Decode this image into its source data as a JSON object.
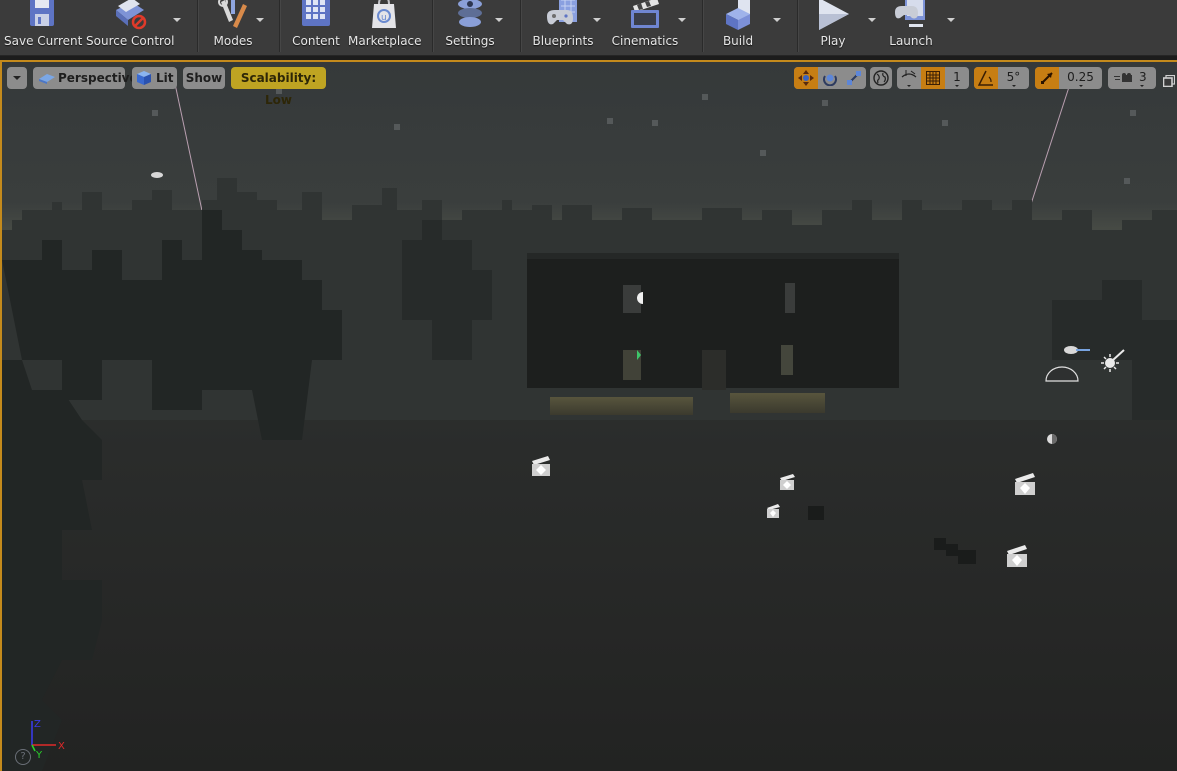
{
  "toolbar": {
    "buttons": [
      {
        "label": "Save Current",
        "icon": "floppy-disk-icon",
        "has_menu": false
      },
      {
        "label": "Source Control",
        "icon": "source-control-icon",
        "has_menu": true
      },
      {
        "label": "Modes",
        "icon": "modes-tools-icon",
        "has_menu": true
      },
      {
        "label": "Content",
        "icon": "content-grid-icon",
        "has_menu": false
      },
      {
        "label": "Marketplace",
        "icon": "marketplace-bag-icon",
        "has_menu": false
      },
      {
        "label": "Settings",
        "icon": "settings-gear-icon",
        "has_menu": true
      },
      {
        "label": "Blueprints",
        "icon": "blueprints-gamepad-icon",
        "has_menu": true
      },
      {
        "label": "Cinematics",
        "icon": "cinematics-clapper-icon",
        "has_menu": true
      },
      {
        "label": "Build",
        "icon": "build-blocks-icon",
        "has_menu": true
      },
      {
        "label": "Play",
        "icon": "play-triangle-icon",
        "has_menu": true
      },
      {
        "label": "Launch",
        "icon": "launch-console-icon",
        "has_menu": true
      }
    ]
  },
  "viewport": {
    "left_controls": {
      "options_menu": "viewport-options",
      "view_mode": "Perspective",
      "lighting_mode": "Lit",
      "show": "Show",
      "scalability": "Scalability: Low"
    },
    "right_controls": {
      "transform_modes": [
        "translate",
        "rotate",
        "scale"
      ],
      "active_transform": "translate",
      "coordinate_space": "world",
      "surface_snapping": "off",
      "grid_snap_enabled": true,
      "grid_snap_value": "1",
      "rotation_snap_enabled": true,
      "rotation_snap_value": "5°",
      "scale_snap_enabled": true,
      "scale_snap_value": "0.25",
      "camera_speed": "3",
      "maximize": "maximize-viewport"
    },
    "axis_gizmo": {
      "x": "X",
      "y": "Y",
      "z": "Z"
    },
    "help": "?",
    "colors": {
      "accent_orange": "#c77e13",
      "scalability_gold": "#bfa422",
      "viewport_border": "#c48a1c",
      "axis_x": "#e02a2a",
      "axis_y": "#2ad12a",
      "axis_z": "#3a3ae6"
    }
  }
}
